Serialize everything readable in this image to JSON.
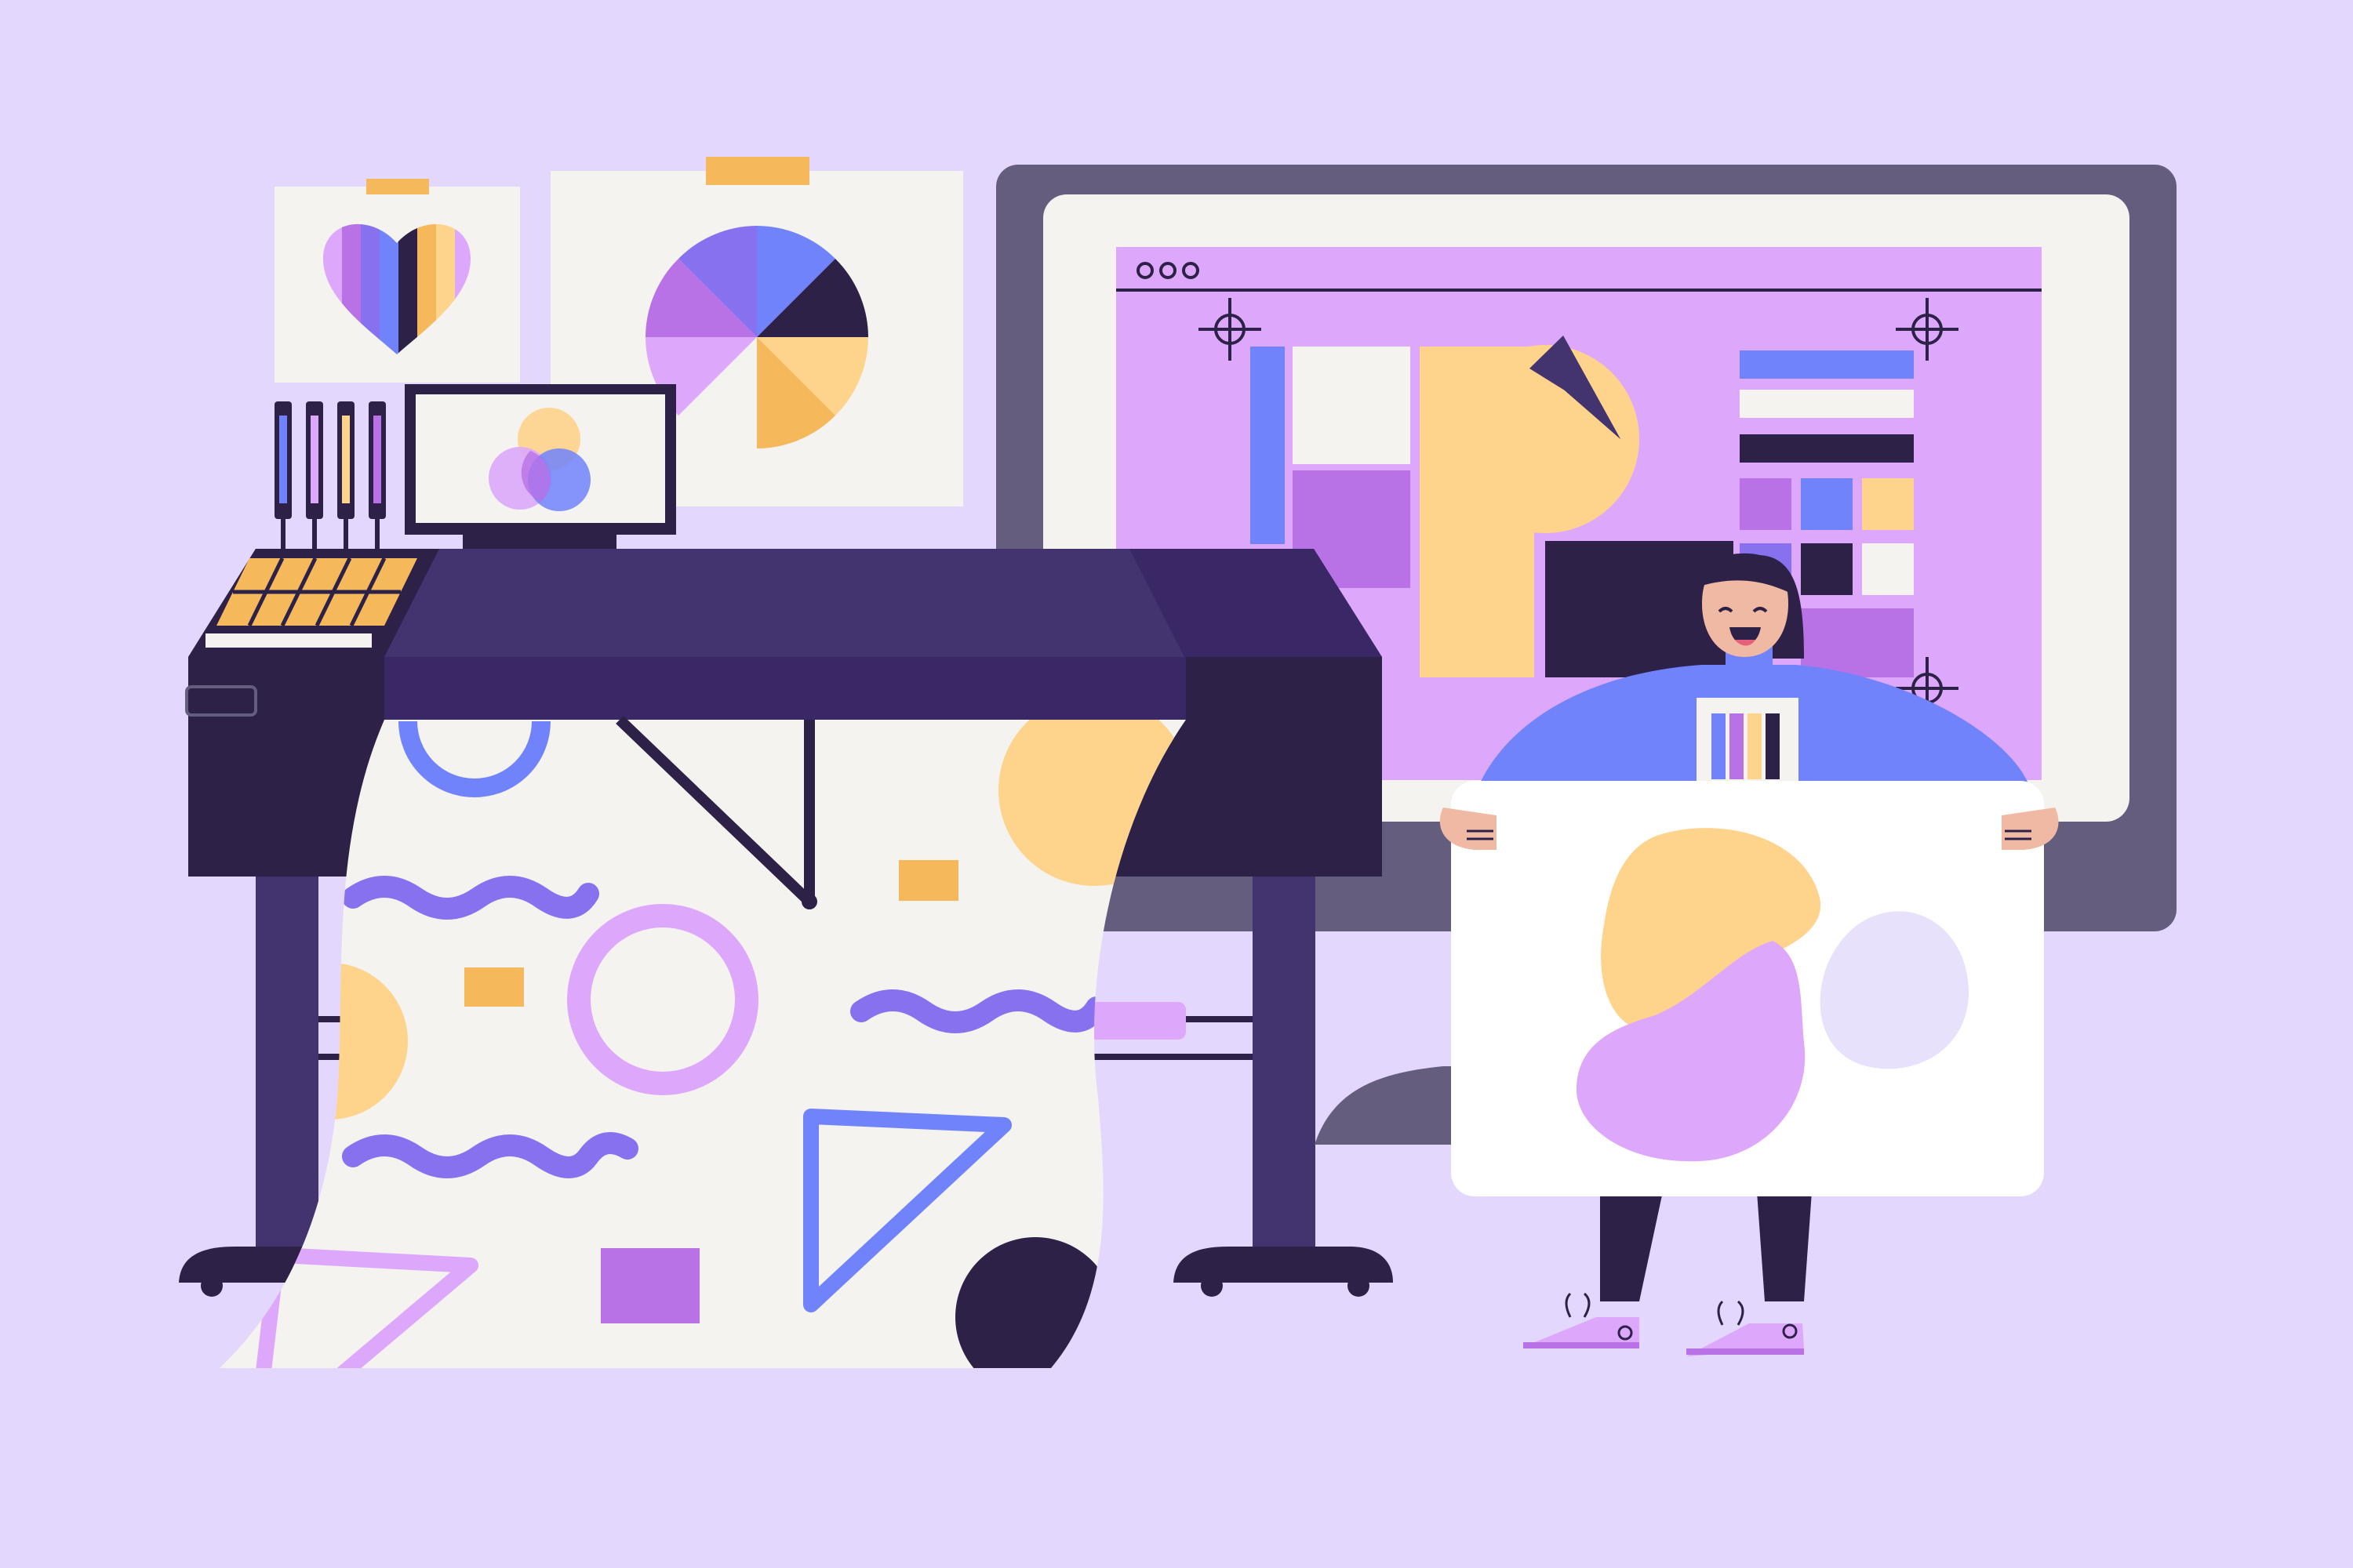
{
  "scene": {
    "style": "flat vector illustration",
    "palette": {
      "background": "#e4d7fd",
      "lavender": "#dda8fb",
      "violet": "#b872e6",
      "periwinkle": "#7083fb",
      "indigo": "#8771ee",
      "dark_purple": "#2e2147",
      "plotter_purple": "#433470",
      "monitor_frame": "#645d7e",
      "paper": "#f4f3ef",
      "yellow": "#fed38c",
      "orange": "#f5b95c",
      "white": "#ffffff"
    },
    "icons": [
      "heart-chart-icon",
      "pie-chart-icon",
      "color-blend-icon",
      "crosshair-icon",
      "window-dots-icon",
      "color-swatch-icon"
    ]
  }
}
